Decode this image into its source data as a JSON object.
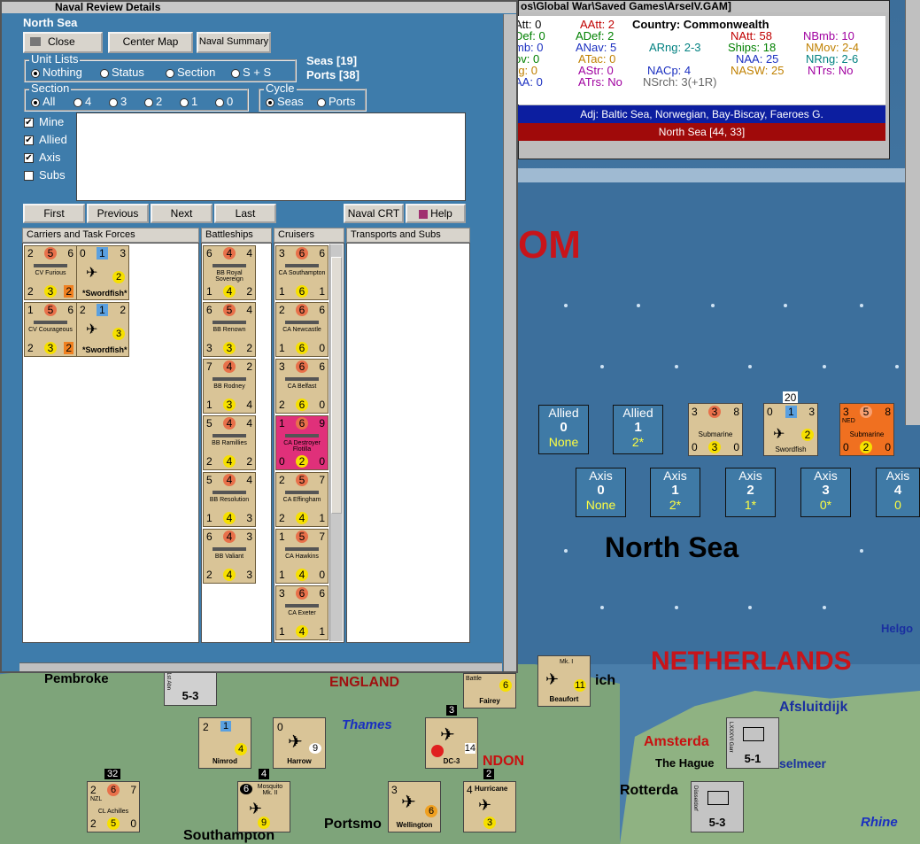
{
  "map_title_bar": "os\\Global War\\Saved Games\\ArseIV.GAM]",
  "naval_window": {
    "title": "Naval Review Details",
    "area": "North Sea",
    "buttons": {
      "close": "Close",
      "center_map": "Center Map",
      "naval_summary": "Naval Summary",
      "first": "First",
      "previous": "Previous",
      "next": "Next",
      "last": "Last",
      "naval_crt": "Naval CRT",
      "help": "Help"
    },
    "seas_count": "Seas [19]",
    "ports_count": "Ports [38]",
    "unit_lists": {
      "label": "Unit Lists",
      "options": [
        "Nothing",
        "Status",
        "Section",
        "S + S"
      ],
      "selected": "Nothing"
    },
    "section": {
      "label": "Section",
      "options": [
        "All",
        "4",
        "3",
        "2",
        "1",
        "0"
      ],
      "selected": "All"
    },
    "cycle": {
      "label": "Cycle",
      "options": [
        "Seas",
        "Ports"
      ],
      "selected": "Seas"
    },
    "filters": [
      {
        "label": "Mine",
        "checked": true
      },
      {
        "label": "Allied",
        "checked": true
      },
      {
        "label": "Axis",
        "checked": true
      },
      {
        "label": "Subs",
        "checked": false
      }
    ],
    "columns": [
      "Carriers and Task Forces",
      "Battleships",
      "Cruisers",
      "Transports and Subs"
    ],
    "carriers": [
      {
        "tl": "2",
        "tc": "5",
        "tr": "6",
        "name": "CV Furious",
        "bl": "2",
        "bc": "3",
        "br": "2",
        "air": {
          "tl": "0",
          "tc": "1",
          "tr": "3",
          "c": "2",
          "name": "Swordfish"
        }
      },
      {
        "tl": "1",
        "tc": "5",
        "tr": "6",
        "name": "CV Courageous",
        "bl": "2",
        "bc": "3",
        "br": "2",
        "air": {
          "tl": "2",
          "tc": "1",
          "tr": "2",
          "c": "3",
          "name": "Swordfish"
        }
      }
    ],
    "battleships": [
      {
        "tl": "6",
        "tc": "4",
        "tr": "4",
        "name": "BB Royal Sovereign",
        "bl": "1",
        "bc": "4",
        "br": "2"
      },
      {
        "tl": "6",
        "tc": "5",
        "tr": "4",
        "name": "BB Renown",
        "bl": "3",
        "bc": "3",
        "br": "2"
      },
      {
        "tl": "7",
        "tc": "4",
        "tr": "2",
        "name": "BB Rodney",
        "bl": "1",
        "bc": "3",
        "br": "4"
      },
      {
        "tl": "5",
        "tc": "4",
        "tr": "4",
        "name": "BB Ramillies",
        "bl": "2",
        "bc": "4",
        "br": "2"
      },
      {
        "tl": "5",
        "tc": "4",
        "tr": "4",
        "name": "BB Resolution",
        "bl": "1",
        "bc": "4",
        "br": "3"
      },
      {
        "tl": "6",
        "tc": "4",
        "tr": "3",
        "name": "BB Valiant",
        "bl": "2",
        "bc": "4",
        "br": "3"
      }
    ],
    "cruisers": [
      {
        "tl": "3",
        "tc": "6",
        "tr": "6",
        "name": "CA Southampton",
        "bl": "1",
        "bc": "6",
        "br": "1"
      },
      {
        "tl": "2",
        "tc": "6",
        "tr": "6",
        "name": "CA Newcastle",
        "bl": "1",
        "bc": "6",
        "br": "0"
      },
      {
        "tl": "3",
        "tc": "6",
        "tr": "6",
        "name": "CA Belfast",
        "bl": "2",
        "bc": "6",
        "br": "0"
      },
      {
        "tl": "1",
        "tc": "6",
        "tr": "9",
        "name": "CA Destroyer Flotilla",
        "bl": "0",
        "bc": "2",
        "br": "0",
        "highlight": true
      },
      {
        "tl": "2",
        "tc": "5",
        "tr": "7",
        "name": "CA Effingham",
        "bl": "2",
        "bc": "4",
        "br": "1"
      },
      {
        "tl": "1",
        "tc": "5",
        "tr": "7",
        "name": "CA Hawkins",
        "bl": "1",
        "bc": "4",
        "br": "0"
      },
      {
        "tl": "3",
        "tc": "6",
        "tr": "6",
        "name": "CA Exeter",
        "bl": "1",
        "bc": "4",
        "br": "1"
      }
    ]
  },
  "info": {
    "rows": [
      [
        "Att: 0",
        "AAtt: 2",
        "Country: Commonwealth",
        "",
        ""
      ],
      [
        "Def: 0",
        "ADef: 2",
        "",
        "NAtt: 58",
        "NBmb: 10"
      ],
      [
        "mb: 0",
        "ANav: 5",
        "ARng: 2-3",
        "Ships: 18",
        "NMov: 2-4"
      ],
      [
        "ov: 0",
        "ATac: 0",
        "",
        "NAA: 25",
        "NRng: 2-6"
      ],
      [
        "rg: 0",
        "AStr: 0",
        "NACp: 4",
        "NASW: 25",
        "NTrs: No"
      ],
      [
        "AA: 0",
        "ATrs: No",
        "NSrch: 3(+1R)",
        "",
        ""
      ]
    ],
    "adj": "Adj: Baltic Sea, Norwegian, Bay-Biscay, Faeroes G.",
    "sea": "North Sea [44, 33]"
  },
  "sea_boxes": {
    "allied": [
      {
        "label": "Allied",
        "value": "0",
        "sub": "None"
      },
      {
        "label": "Allied",
        "value": "1",
        "sub": "2*"
      }
    ],
    "axis": [
      {
        "label": "Axis",
        "value": "0",
        "sub": "None"
      },
      {
        "label": "Axis",
        "value": "1",
        "sub": "2*"
      },
      {
        "label": "Axis",
        "value": "2",
        "sub": "1*"
      },
      {
        "label": "Axis",
        "value": "3",
        "sub": "0*"
      },
      {
        "label": "Axis",
        "value": "4",
        "sub": "0"
      }
    ]
  },
  "map_units": [
    {
      "name": "Submarine",
      "tl": "3",
      "tc": "3",
      "tr": "8",
      "bl": "0",
      "bc": "3",
      "br": "0"
    },
    {
      "name": "Swordfish",
      "tl": "0",
      "tc": "1",
      "tr": "3",
      "bc": "2",
      "stack": "20"
    },
    {
      "name": "Submarine",
      "tl": "3",
      "tc": "5",
      "tr": "8",
      "bl": "0",
      "bc": "2",
      "br": "0",
      "flag": "NED"
    }
  ],
  "map_labels": {
    "sea": "North Sea",
    "uk_partial": "OM",
    "netherlands": "NETHERLANDS",
    "england": "ENGLAND",
    "pembroke": "Pembroke",
    "thames": "Thames",
    "london": "NDON",
    "amsterdam": "Amsterda",
    "afsluitdijk": "Afsluitdijk",
    "hague": "The Hague",
    "rotterdam": "Rotterda",
    "rhine": "Rhine",
    "helgo": "Helgo",
    "southampton": "Southampton",
    "portsmouth": "Portsmo",
    "ijssel": "selmeer",
    "ich": "ich"
  },
  "land_units": [
    {
      "name": "Nimrod",
      "top": "2",
      "s": "1",
      "val": "4"
    },
    {
      "name": "Harrow",
      "top": "0",
      "val": "9"
    },
    {
      "name": "DC-3",
      "val": "14",
      "stack": "3"
    },
    {
      "name": "CL Achilles",
      "tl": "2",
      "tc": "6",
      "tr": "7",
      "bl": "2",
      "bc": "5",
      "br": "0",
      "stack": "32",
      "flag": "NZL"
    },
    {
      "name": "Mosquito Mk. II",
      "top": "6",
      "val": "9",
      "stack": "4"
    },
    {
      "name": "Wellington",
      "top": "3",
      "val": "6",
      "b": "3"
    },
    {
      "name": "Hurricane",
      "top": "4",
      "val": "3",
      "stack": "2"
    },
    {
      "name": "Fairey",
      "val": "6",
      "top": "Battle"
    },
    {
      "name": "Beaufort",
      "top": "Mk. I",
      "val": "11"
    },
    {
      "name": "LXXXVI Garr",
      "val": "5-1"
    },
    {
      "name": "Düsseldorf",
      "val": "5-3"
    },
    {
      "name": "1st Abn",
      "val": "5-3"
    }
  ]
}
